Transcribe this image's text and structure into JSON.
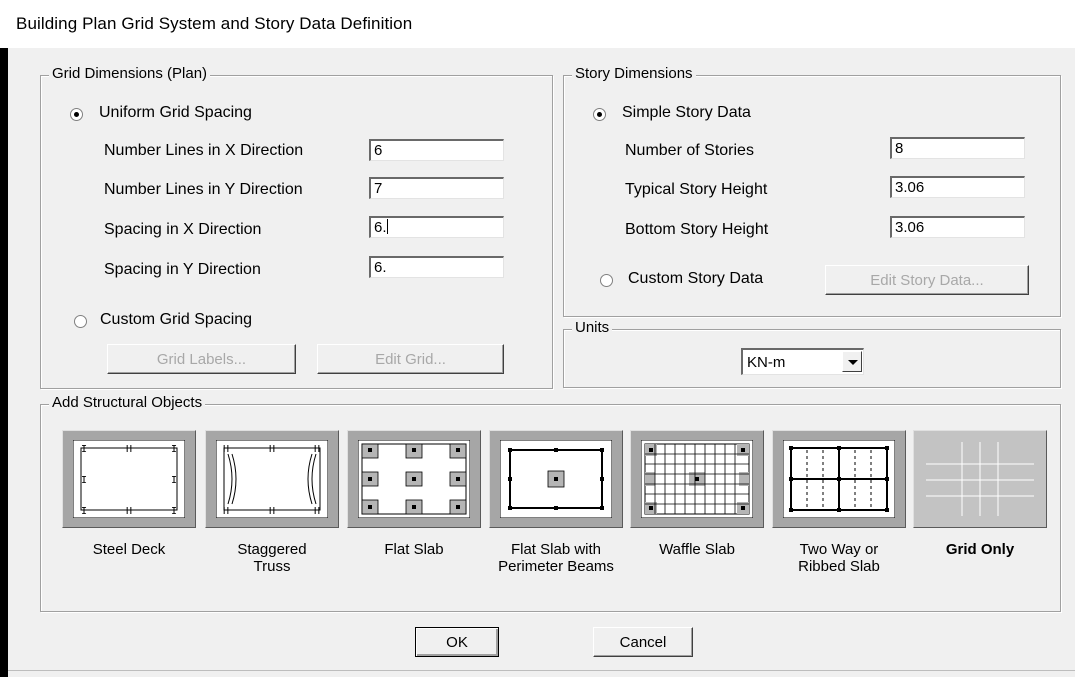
{
  "window": {
    "title": "Building Plan Grid System and Story Data Definition"
  },
  "grid_dimensions": {
    "legend": "Grid Dimensions (Plan)",
    "uniform_label": "Uniform Grid Spacing",
    "uniform_selected": true,
    "fields": [
      {
        "label": "Number Lines in X Direction",
        "value": "6"
      },
      {
        "label": "Number Lines in Y Direction",
        "value": "7"
      },
      {
        "label": "Spacing in X Direction",
        "value": "6."
      },
      {
        "label": "Spacing in Y Direction",
        "value": "6."
      }
    ],
    "custom_label": "Custom Grid Spacing",
    "grid_labels_button": "Grid Labels...",
    "edit_grid_button": "Edit Grid..."
  },
  "story_dimensions": {
    "legend": "Story Dimensions",
    "simple_label": "Simple Story Data",
    "simple_selected": true,
    "fields": [
      {
        "label": "Number of Stories",
        "value": "8"
      },
      {
        "label": "Typical Story Height",
        "value": "3.06"
      },
      {
        "label": "Bottom Story Height",
        "value": "3.06"
      }
    ],
    "custom_label": "Custom Story Data",
    "edit_story_button": "Edit Story Data..."
  },
  "units": {
    "legend": "Units",
    "selected": "KN-m"
  },
  "structural_objects": {
    "legend": "Add Structural Objects",
    "options": [
      {
        "line1": "Steel Deck",
        "line2": ""
      },
      {
        "line1": "Staggered",
        "line2": "Truss"
      },
      {
        "line1": "Flat Slab",
        "line2": ""
      },
      {
        "line1": "Flat Slab with",
        "line2": "Perimeter Beams"
      },
      {
        "line1": "Waffle Slab",
        "line2": ""
      },
      {
        "line1": "Two Way or",
        "line2": "Ribbed Slab"
      },
      {
        "line1": "Grid Only",
        "line2": ""
      }
    ],
    "selected": "Grid Only"
  },
  "buttons": {
    "ok": "OK",
    "cancel": "Cancel"
  }
}
